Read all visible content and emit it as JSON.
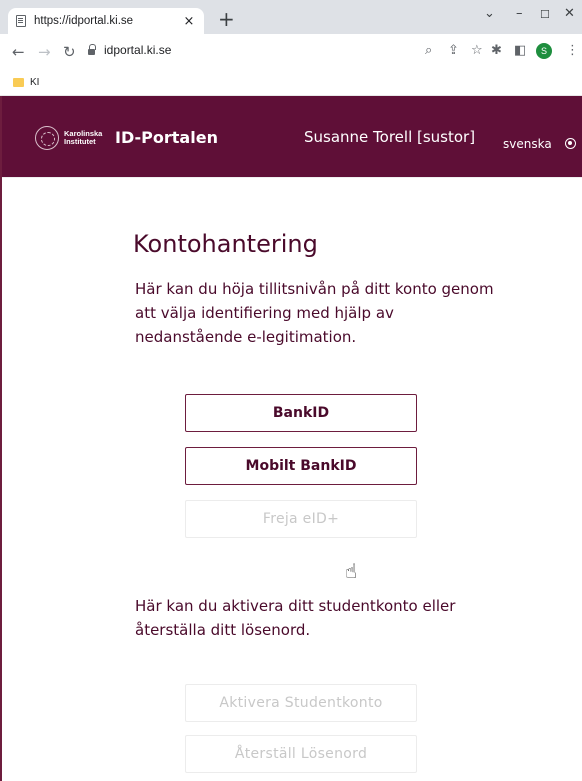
{
  "browser": {
    "tab_title": "https://idportal.ki.se",
    "tab_close": "×",
    "new_tab": "+",
    "url": "idportal.ki.se",
    "bookmark_folder": "KI",
    "profile_initial": "S"
  },
  "header": {
    "logo_text_line1": "Karolinska",
    "logo_text_line2": "Institutet",
    "site_title": "ID-Portalen",
    "user": "Susanne Torell [sustor]",
    "language": "svenska"
  },
  "main": {
    "heading": "Kontohantering",
    "intro": "Här kan du höja tillitsnivån på ditt konto genom att välja identifiering med hjälp av nedanstående e-legitimation.",
    "buttons": {
      "bankid": "BankID",
      "mobilt_bankid": "Mobilt BankID",
      "freja": "Freja eID+"
    },
    "student_text": "Här kan du aktivera ditt studentkonto eller återställa ditt lösenord.",
    "student_buttons": {
      "activate": "Aktivera Studentkonto",
      "reset": "Återställ Lösenord"
    }
  },
  "colors": {
    "brand": "#5f0f37",
    "text": "#4a0a2b",
    "disabled": "#c8c8c8"
  }
}
